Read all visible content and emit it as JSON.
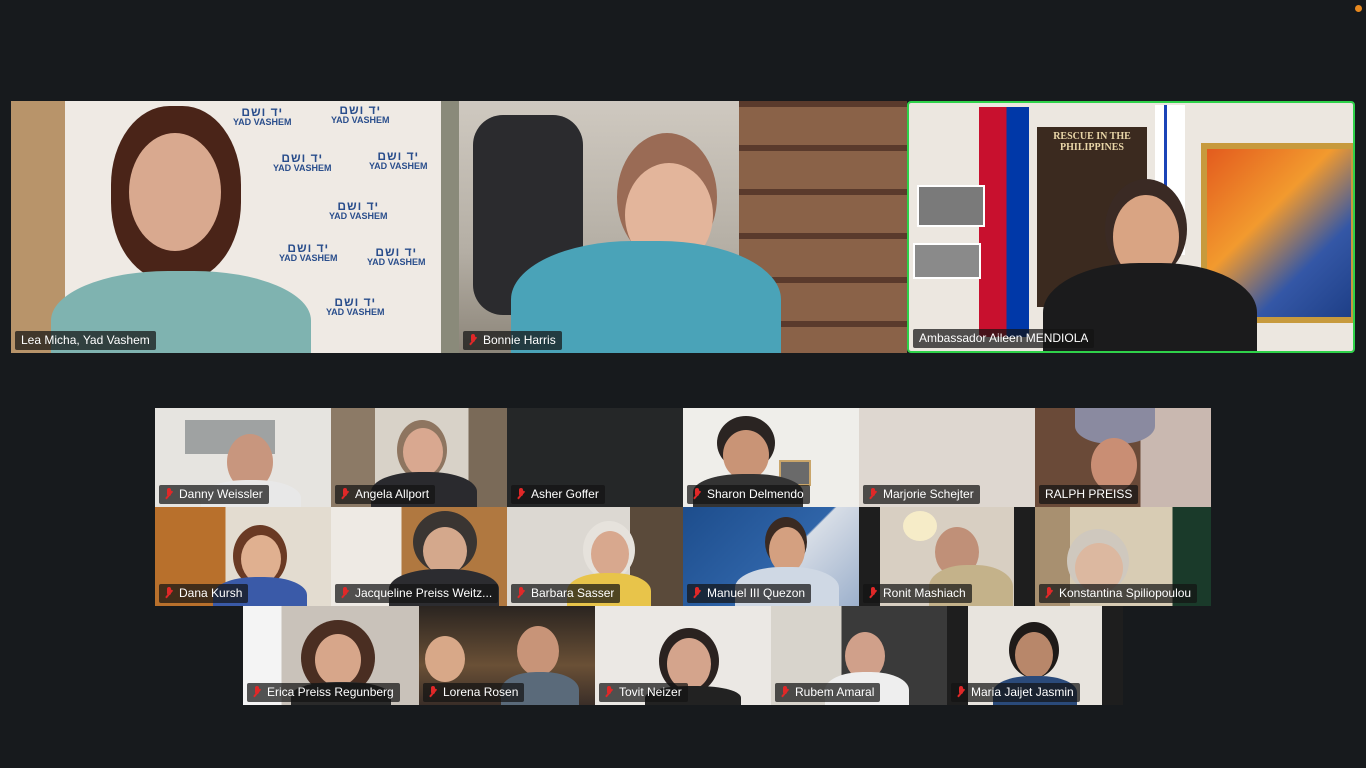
{
  "window": {
    "indicator_color": "#e8891f"
  },
  "speaker_tiles": [
    {
      "name": "Lea Micha, Yad Vashem",
      "muted": false,
      "active": false,
      "backdrop_logo": {
        "hebrew": "יד ושם",
        "latin": "YAD VASHEM"
      }
    },
    {
      "name": "Bonnie Harris",
      "muted": true,
      "active": false
    },
    {
      "name": "Ambassador Aileen MENDIOLA",
      "muted": false,
      "active": true,
      "poster_title": "RESCUE IN THE PHILIPPINES"
    }
  ],
  "gallery": {
    "rows": [
      [
        {
          "name": "Danny Weissler",
          "muted": true
        },
        {
          "name": "Angela Allport",
          "muted": true
        },
        {
          "name": "Asher Goffer",
          "muted": true
        },
        {
          "name": "Sharon Delmendo",
          "muted": true
        },
        {
          "name": "Marjorie Schejter",
          "muted": true
        },
        {
          "name": "RALPH PREISS",
          "muted": false
        }
      ],
      [
        {
          "name": "Dana Kursh",
          "muted": true
        },
        {
          "name": "Jacqueline Preiss Weitz...",
          "muted": true
        },
        {
          "name": "Barbara Sasser",
          "muted": true
        },
        {
          "name": "Manuel III Quezon",
          "muted": true
        },
        {
          "name": "Ronit Mashiach",
          "muted": true
        },
        {
          "name": "Konstantina Spiliopoulou",
          "muted": true
        }
      ],
      [
        {
          "name": "Erica Preiss Regunberg",
          "muted": true
        },
        {
          "name": "Lorena Rosen",
          "muted": true
        },
        {
          "name": "Tovit Neizer",
          "muted": true
        },
        {
          "name": "Rubem Amaral",
          "muted": true
        },
        {
          "name": "Maria Jaijet Jasmin",
          "muted": true
        }
      ]
    ]
  },
  "colors": {
    "muted_mic": "#e02828",
    "active_speaker_border": "#2fd14a",
    "background": "#171a1d"
  }
}
